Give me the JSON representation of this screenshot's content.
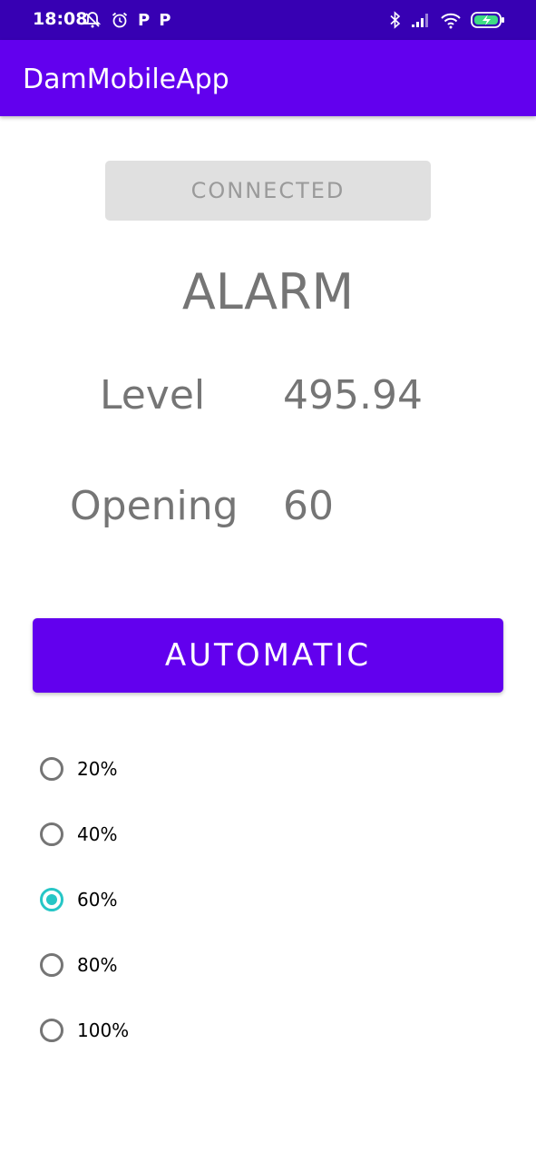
{
  "status_bar": {
    "time": "18:08",
    "left_icons": [
      "muted-notification-icon",
      "alarm-clock-icon",
      "p-icon",
      "p-icon"
    ],
    "p_glyph": "P",
    "right_icons": [
      "bluetooth-icon",
      "signal-icon",
      "wifi-icon",
      "battery-charging-icon"
    ]
  },
  "app_bar": {
    "title": "DamMobileApp",
    "color": "#6200ee",
    "status_color": "#3700b3"
  },
  "connection": {
    "button_label": "CONNECTED"
  },
  "state": {
    "alarm_text": "ALARM"
  },
  "readings": {
    "level_label": "Level",
    "level_value": "495.94",
    "opening_label": "Opening",
    "opening_value": "60"
  },
  "mode_button": {
    "label": "AUTOMATIC",
    "color": "#6200ee"
  },
  "opening_options": {
    "selected": "60%",
    "accent_color": "#26c6c6",
    "items": [
      {
        "label": "20%"
      },
      {
        "label": "40%"
      },
      {
        "label": "60%"
      },
      {
        "label": "80%"
      },
      {
        "label": "100%"
      }
    ]
  }
}
